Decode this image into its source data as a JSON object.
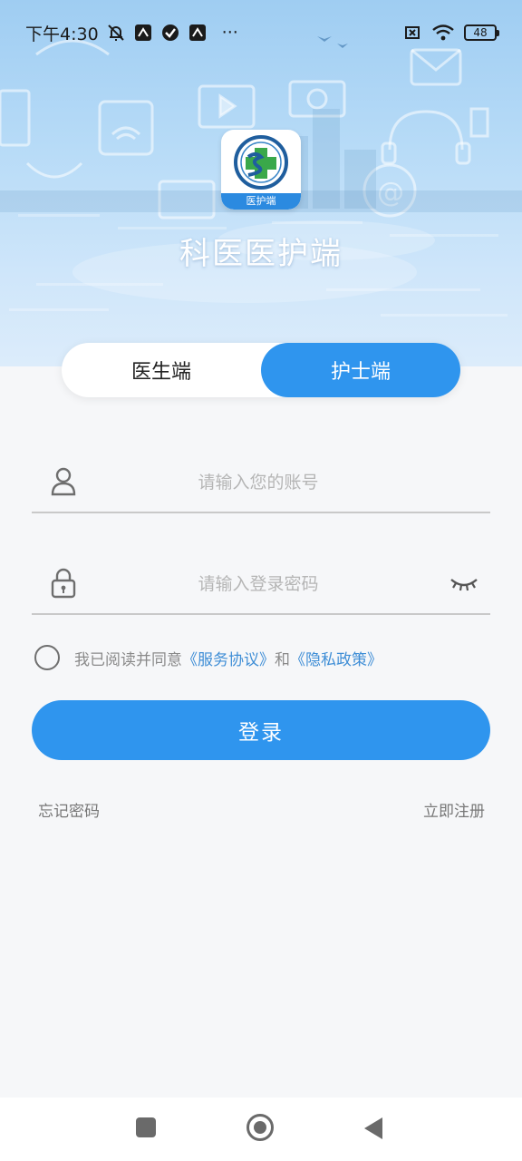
{
  "status_bar": {
    "time": "下午4:30",
    "more": "···",
    "battery": "48",
    "icons": [
      "bell-off-icon",
      "app-notify-icon",
      "check-circle-icon",
      "app-notify-icon",
      "sim-x-icon",
      "wifi-icon",
      "battery-icon"
    ]
  },
  "header": {
    "logo_tag": "医护端",
    "app_title": "科医医护端"
  },
  "role_switch": {
    "doctor": "医生端",
    "nurse": "护士端",
    "active": "nurse"
  },
  "form": {
    "account_placeholder": "请输入您的账号",
    "password_placeholder": "请输入登录密码",
    "account_value": "",
    "password_value": ""
  },
  "agreement": {
    "prefix": "我已阅读并同意",
    "service": "《服务协议》",
    "and": "和",
    "privacy": "《隐私政策》"
  },
  "login_label": "登录",
  "links": {
    "forgot": "忘记密码",
    "register": "立即注册"
  },
  "colors": {
    "primary": "#2f95ee",
    "link": "#3f8ed6",
    "background": "#f6f7f9"
  }
}
